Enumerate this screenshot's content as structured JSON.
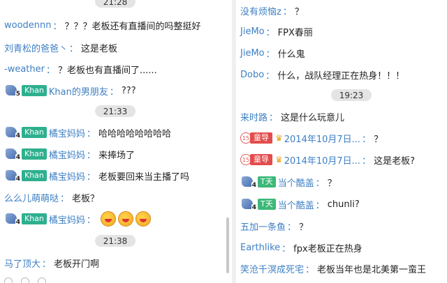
{
  "left": {
    "times": [
      "21:28",
      "21:33",
      "21:38"
    ],
    "messages": [
      {
        "user": "woodennn",
        "sep": "：",
        "text": "？？？老板还有直播间的吗整挺好"
      },
      {
        "user": "刘青松的爸爸丶",
        "sep": "：",
        "text": "这是老板"
      },
      {
        "user": "-weather",
        "sep": "：",
        "text": "？老板也有直播间了......"
      },
      {
        "user": "Khan的男朋友",
        "sep": "：",
        "text": "???",
        "level": "5",
        "tag": "Khan"
      },
      {
        "user": "橘宝妈妈",
        "sep": "：",
        "text": "哈哈哈哈哈哈哈哈",
        "level": "4",
        "tag": "Khan"
      },
      {
        "user": "橘宝妈妈",
        "sep": "：",
        "text": "来捧场了",
        "level": "4",
        "tag": "Khan"
      },
      {
        "user": "橘宝妈妈",
        "sep": "：",
        "text": "老板要回来当主播了吗",
        "level": "4",
        "tag": "Khan"
      },
      {
        "user": "么么儿萌萌哒",
        "sep": "：",
        "text": "老板？"
      },
      {
        "user": "橘宝妈妈",
        "sep": "：",
        "text": "",
        "level": "4",
        "tag": "Khan",
        "emojis": [
          "doge-emoji",
          "doge-emoji",
          "doge-emoji"
        ]
      },
      {
        "user": "马了顶大",
        "sep": "：",
        "text": "老板开门啊"
      }
    ]
  },
  "right": {
    "times": [
      "19:23"
    ],
    "messages": [
      {
        "user": "没有烦恼z",
        "sep": "：",
        "text": "？"
      },
      {
        "user": "JieMo",
        "sep": "：",
        "text": "FPX春丽"
      },
      {
        "user": "JieMo",
        "sep": "：",
        "text": "什么鬼"
      },
      {
        "user": "Dobo",
        "sep": "：",
        "text": "什么，战队经理正在热身！！！"
      },
      {
        "user": "来时路",
        "sep": "：",
        "text": "这是什么玩意儿"
      },
      {
        "user": "2014年10月7日...",
        "sep": "：",
        "text": "？",
        "level": "15",
        "tag": "童导"
      },
      {
        "user": "2014年10月7日...",
        "sep": "：",
        "text": "这是老板?",
        "level": "15",
        "tag": "童导"
      },
      {
        "user": "当个酷盖",
        "sep": "：",
        "text": "？",
        "level": "4",
        "tag": "T天"
      },
      {
        "user": "当个酷盖",
        "sep": "：",
        "text": "chunli?",
        "level": "4",
        "tag": "T天"
      },
      {
        "user": "五加一条鱼",
        "sep": "：",
        "text": "？"
      },
      {
        "user": "Earthlike",
        "sep": "：",
        "text": "fpx老板正在热身"
      },
      {
        "user": "笑沧千溟成死宅",
        "sep": "：",
        "text": "老板当年也是北美第一蛮王"
      }
    ]
  }
}
